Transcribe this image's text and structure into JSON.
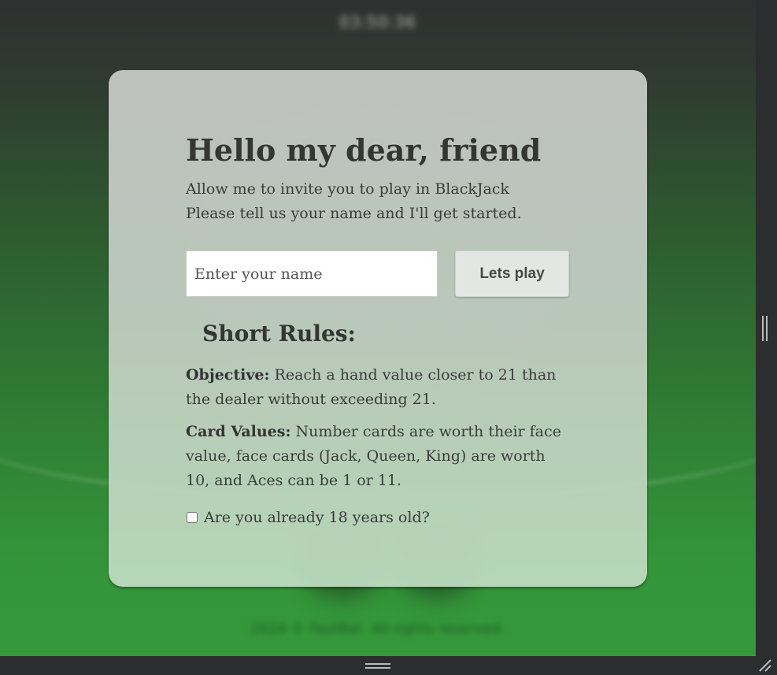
{
  "background": {
    "clock_text": "03:50:36",
    "footer_text": "2024 © FastBet. All rights reserved.",
    "watermark_text": "JACK"
  },
  "modal": {
    "title": "Hello my dear, friend",
    "subtitle_lines": [
      "Allow me to invite you to play in BlackJack",
      "Please tell us your name and I'll get started."
    ],
    "name_input": {
      "value": "",
      "placeholder": "Enter your name"
    },
    "play_button_label": "Lets play",
    "rules_title": "Short Rules:",
    "rules": [
      {
        "label": "Objective:",
        "text": " Reach a hand value closer to 21 than the dealer without exceeding 21."
      },
      {
        "label": "Card Values:",
        "text": " Number cards are worth their face value, face cards (Jack, Queen, King) are worth 10, and Aces can be 1 or 11."
      }
    ],
    "age_checkbox": {
      "label": "Are you already 18 years old?",
      "checked": false
    }
  },
  "colors": {
    "background_top": "#2f3030",
    "background_bottom": "#35993b",
    "modal_bg": "#c3cbc3",
    "text_dark": "#343634",
    "button_bg": "#e4e6e4"
  }
}
